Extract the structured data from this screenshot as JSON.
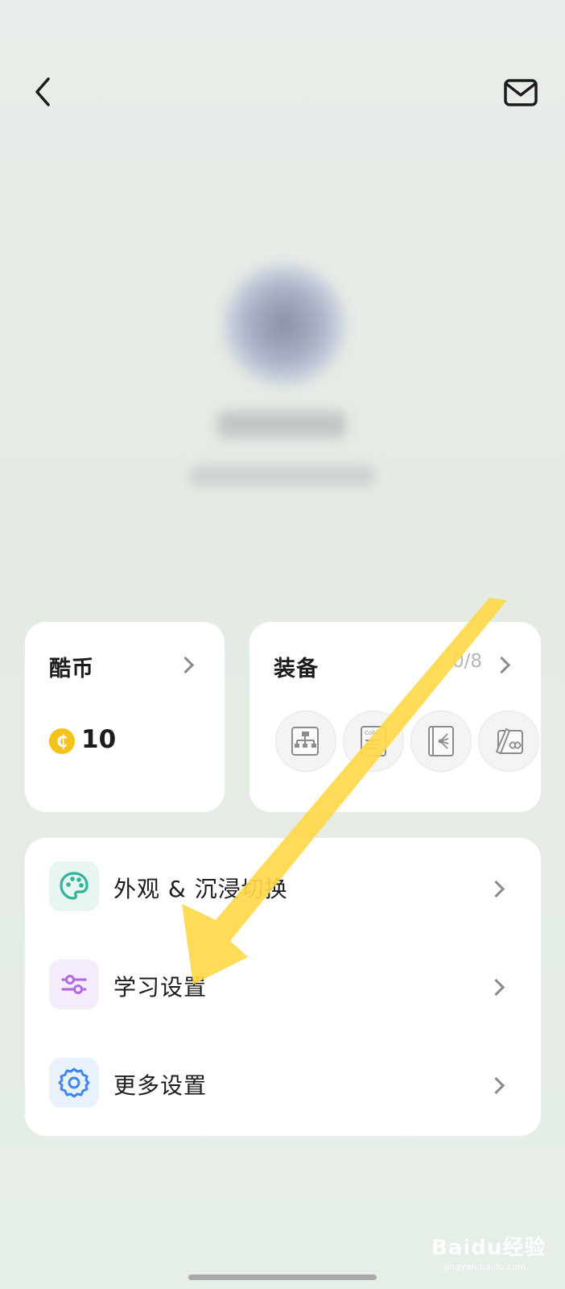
{
  "header": {
    "back_icon": "chevron-left-icon",
    "mail_icon": "mail-icon"
  },
  "coin_card": {
    "title": "酷币",
    "value": "10",
    "coin_symbol": "₵",
    "coin_color": "#f5c21b"
  },
  "equip_card": {
    "title": "装备",
    "count": "0/8",
    "slots": [
      "org-chart-icon",
      "collins-dictionary-icon",
      "mind-map-book-icon",
      "pen-notebook-icon"
    ],
    "slot_label_text": "Collin"
  },
  "menu": {
    "items": [
      {
        "label": "外观 & 沉浸切换",
        "icon": "palette-icon",
        "icon_color": "#2fb59a",
        "icon_bg": "#e7f6f1"
      },
      {
        "label": "学习设置",
        "icon": "sliders-icon",
        "icon_color": "#b46be0",
        "icon_bg": "#f4ecfb"
      },
      {
        "label": "更多设置",
        "icon": "gear-icon",
        "icon_color": "#3f86e8",
        "icon_bg": "#e9f1fc"
      }
    ]
  },
  "annotation": {
    "arrow_color": "#ffd84a"
  },
  "watermark": {
    "text": "Baidu经验",
    "sub": "jingyan.baidu.com"
  }
}
